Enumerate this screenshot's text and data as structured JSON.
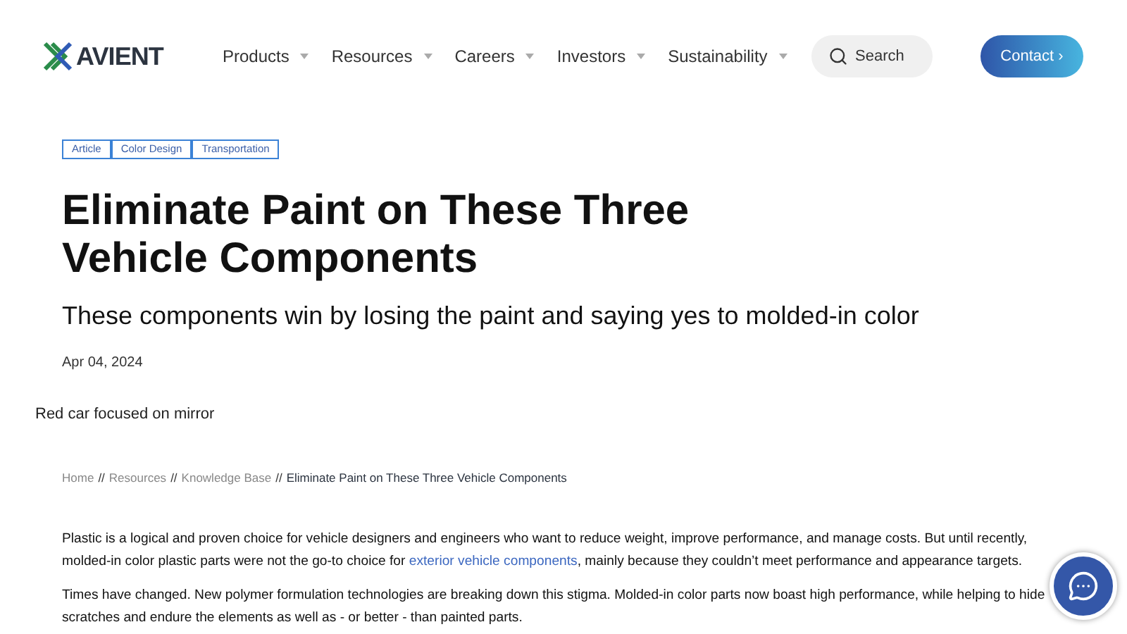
{
  "header": {
    "logo": "AVIENT",
    "nav": [
      {
        "label": "Products"
      },
      {
        "label": "Resources"
      },
      {
        "label": "Careers"
      },
      {
        "label": "Investors"
      },
      {
        "label": "Sustainability"
      }
    ],
    "search": {
      "placeholder": "Search"
    },
    "contact": {
      "label": "Contact",
      "arrow": "›"
    }
  },
  "tags": [
    "Article",
    "Color Design",
    "Transportation"
  ],
  "title": "Eliminate Paint on These Three Vehicle Components",
  "subtitle": "These components win by losing the paint and saying yes to molded-in color",
  "date": "Apr 04, 2024",
  "image_alt": "Red car focused on mirror",
  "breadcrumb": {
    "separator": "//",
    "items": [
      {
        "label": "Home"
      },
      {
        "label": "Resources"
      },
      {
        "label": "Knowledge Base"
      }
    ],
    "current": "Eliminate Paint on These Three Vehicle Components"
  },
  "paragraphs": [
    {
      "before": "Plastic is a logical and proven choice for vehicle designers and engineers who want to reduce weight, improve performance, and manage costs. But until recently, molded-in color plastic parts were not the go-to choice for ",
      "link": "exterior vehicle components",
      "after": ", mainly because they couldn’t meet performance and appearance targets."
    },
    {
      "before": "Times have changed. New polymer formulation technologies are breaking down this stigma. Molded-in color parts now boast high performance, while helping to hide scratches and endure the elements as well as - or better - than painted parts."
    }
  ]
}
